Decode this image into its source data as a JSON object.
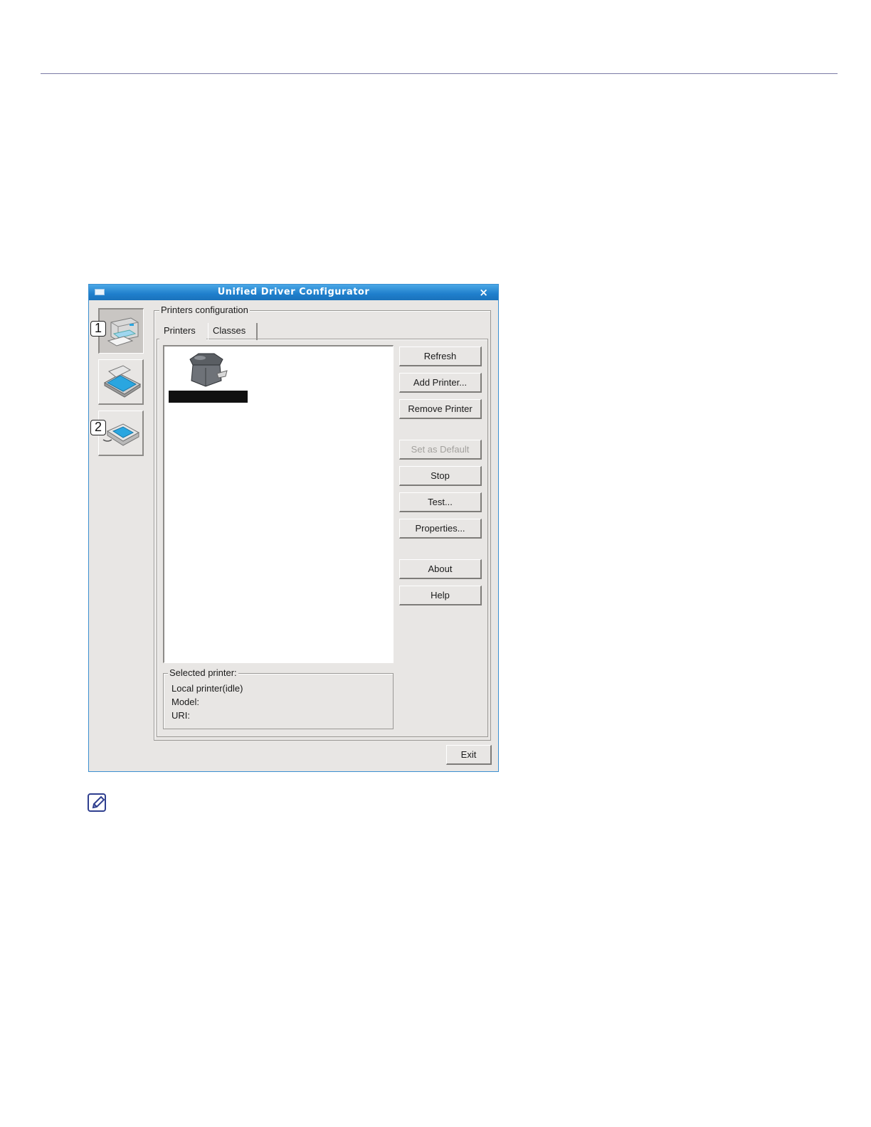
{
  "window": {
    "title": "Unified Driver Configurator",
    "close_glyph": "×"
  },
  "callouts": [
    "1",
    "2"
  ],
  "sidebar": {
    "items": [
      {
        "name": "printers-configuration",
        "icon": "printer-icon",
        "active": true
      },
      {
        "name": "scanners-configuration",
        "icon": "scanner-icon",
        "active": false
      },
      {
        "name": "ports-configuration",
        "icon": "port-icon",
        "active": false
      }
    ]
  },
  "printers_config": {
    "legend": "Printers configuration",
    "tabs": [
      {
        "label": "Printers",
        "active": true
      },
      {
        "label": "Classes",
        "active": false
      }
    ]
  },
  "buttons": {
    "refresh": "Refresh",
    "add_printer": "Add Printer...",
    "remove_printer": "Remove Printer",
    "set_default": "Set as Default",
    "stop": "Stop",
    "test": "Test...",
    "properties": "Properties...",
    "about": "About",
    "help": "Help",
    "exit": "Exit"
  },
  "selected_printer": {
    "legend": "Selected printer:",
    "status": "Local printer(idle)",
    "model_label": "Model:",
    "uri_label": "URI:"
  },
  "colors": {
    "titlebar": "#1f7fcc",
    "window_bg": "#e8e6e4",
    "icon_blue": "#2aa6e0"
  }
}
